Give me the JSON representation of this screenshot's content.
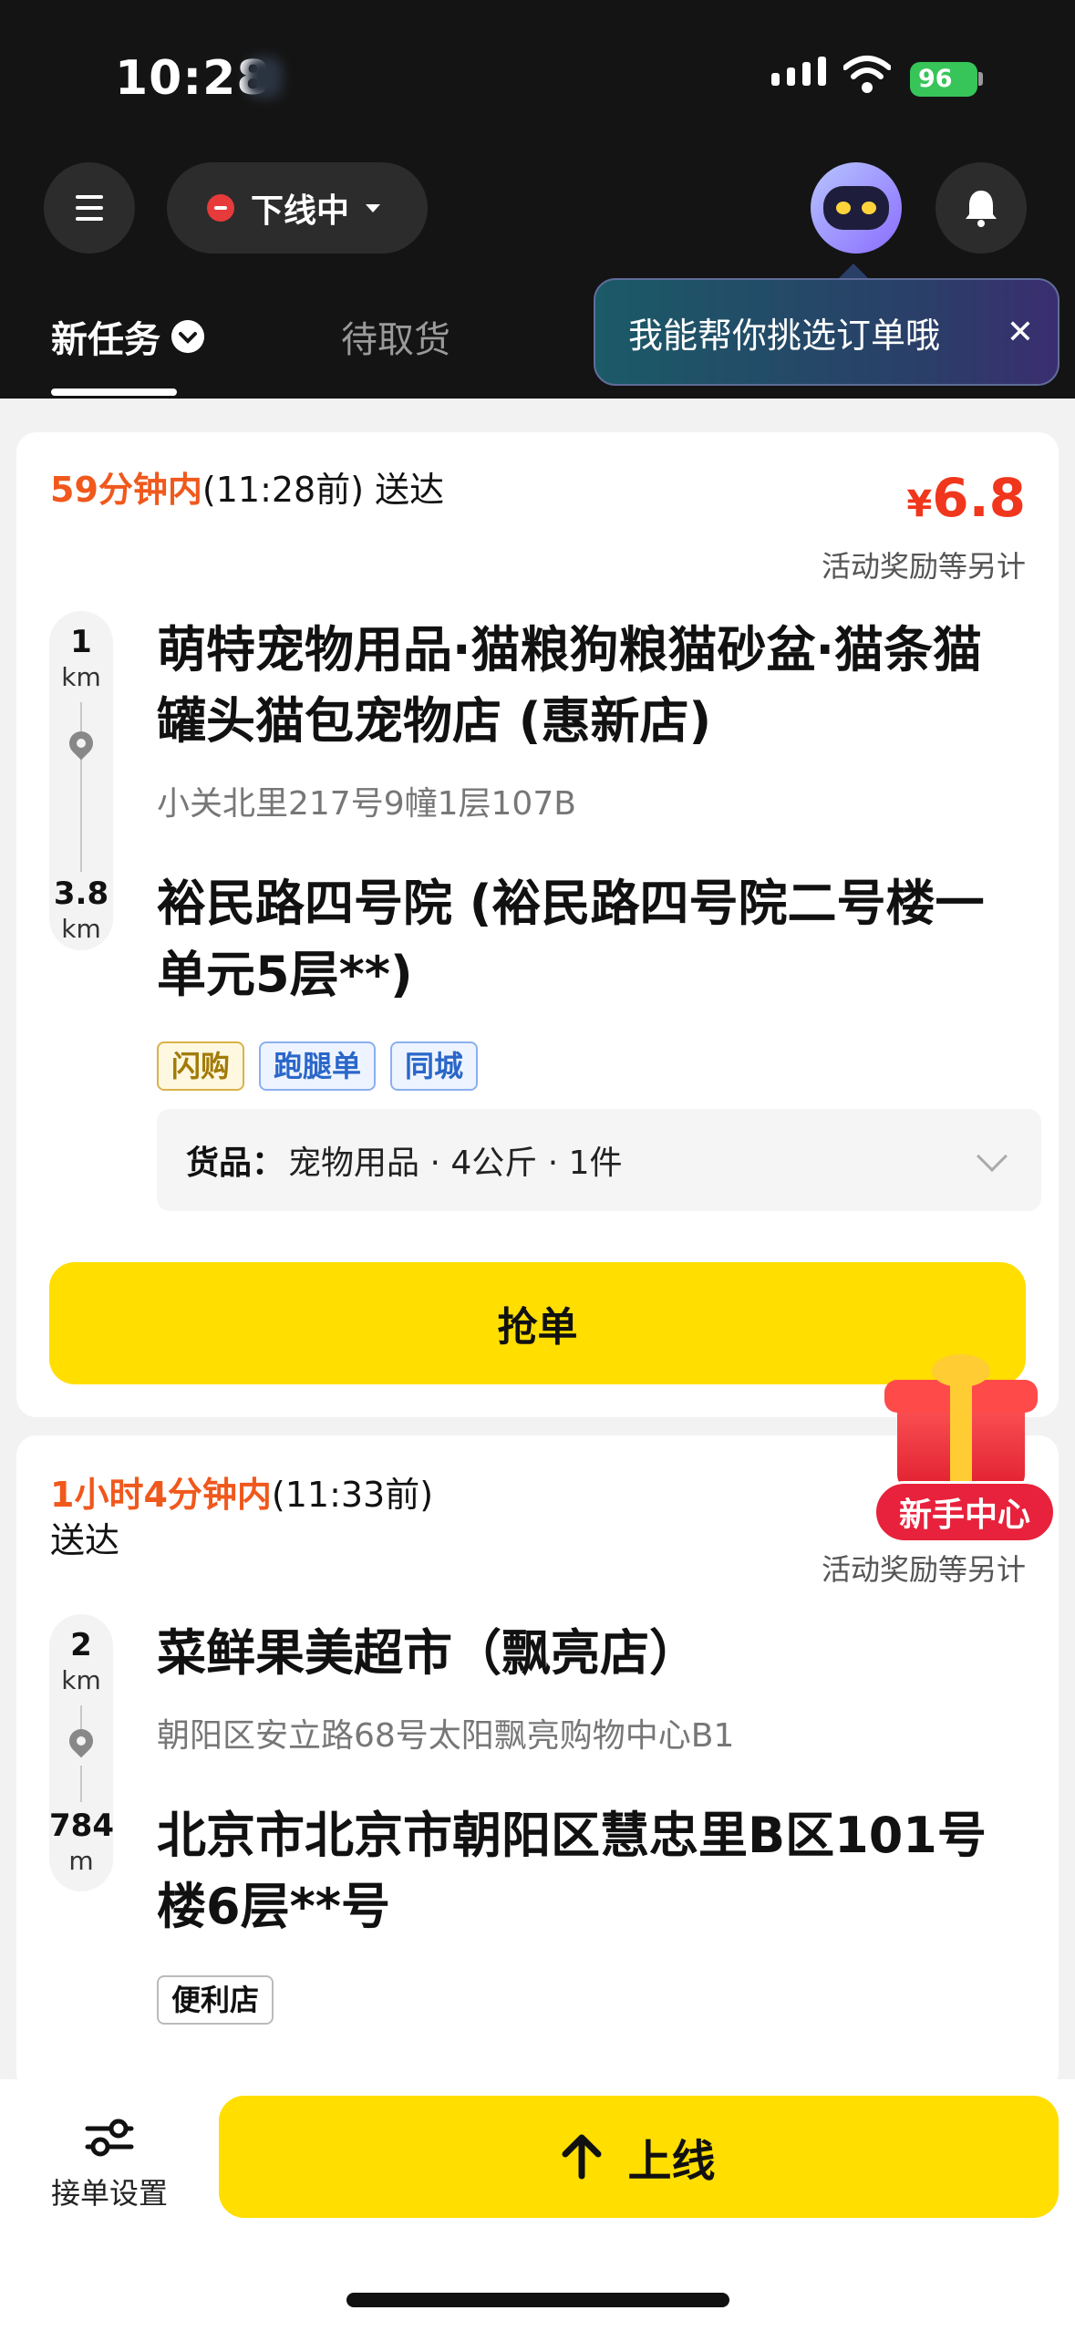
{
  "status_bar": {
    "time": "10:28",
    "battery": "96"
  },
  "header": {
    "online_status": "下线中",
    "tabs": [
      {
        "label": "新任务",
        "active": true
      },
      {
        "label": "待取货",
        "active": false
      }
    ],
    "assistant_tooltip": "我能帮你挑选订单哦"
  },
  "orders": [
    {
      "deadline_highlight": "59分钟内",
      "deadline_rest": "(11:28前) 送达",
      "price_symbol": "¥",
      "price": "6.8",
      "bonus_note": "活动奖励等另计",
      "pickup_distance_value": "1",
      "pickup_distance_unit": "km",
      "pickup_name": "萌特宠物用品·猫粮狗粮猫砂盆·猫条猫罐头猫包宠物店 (惠新店)",
      "pickup_address": "小关北里217号9幢1层107B",
      "dropoff_distance_value": "3.8",
      "dropoff_distance_unit": "km",
      "dropoff_name": "裕民路四号院 (裕民路四号院二号楼一单元5层**)",
      "tags": [
        "闪购",
        "跑腿单",
        "同城"
      ],
      "goods_label": "货品：",
      "goods_value": "宠物用品 · 4公斤 · 1件",
      "grab_button": "抢单"
    },
    {
      "deadline_highlight": "1小时4分钟内",
      "deadline_rest": "(11:33前)",
      "deadline_line2": "送达",
      "bonus_note": "活动奖励等另计",
      "pickup_distance_value": "2",
      "pickup_distance_unit": "km",
      "pickup_name": "菜鲜果美超市（飘亮店）",
      "pickup_address": "朝阳区安立路68号太阳飘亮购物中心B1",
      "dropoff_distance_value": "784",
      "dropoff_distance_unit": "m",
      "dropoff_name": "北京市北京市朝阳区慧忠里B区101号楼6层**号",
      "tags": [
        "便利店"
      ]
    }
  ],
  "newbie_center": "新手中心",
  "bottom_bar": {
    "settings_label": "接单设置",
    "online_button": "上线"
  },
  "colors": {
    "accent_yellow": "#ffde00",
    "deadline_orange": "#f0581c",
    "price_red": "#f0361c",
    "header_bg": "#141414"
  }
}
